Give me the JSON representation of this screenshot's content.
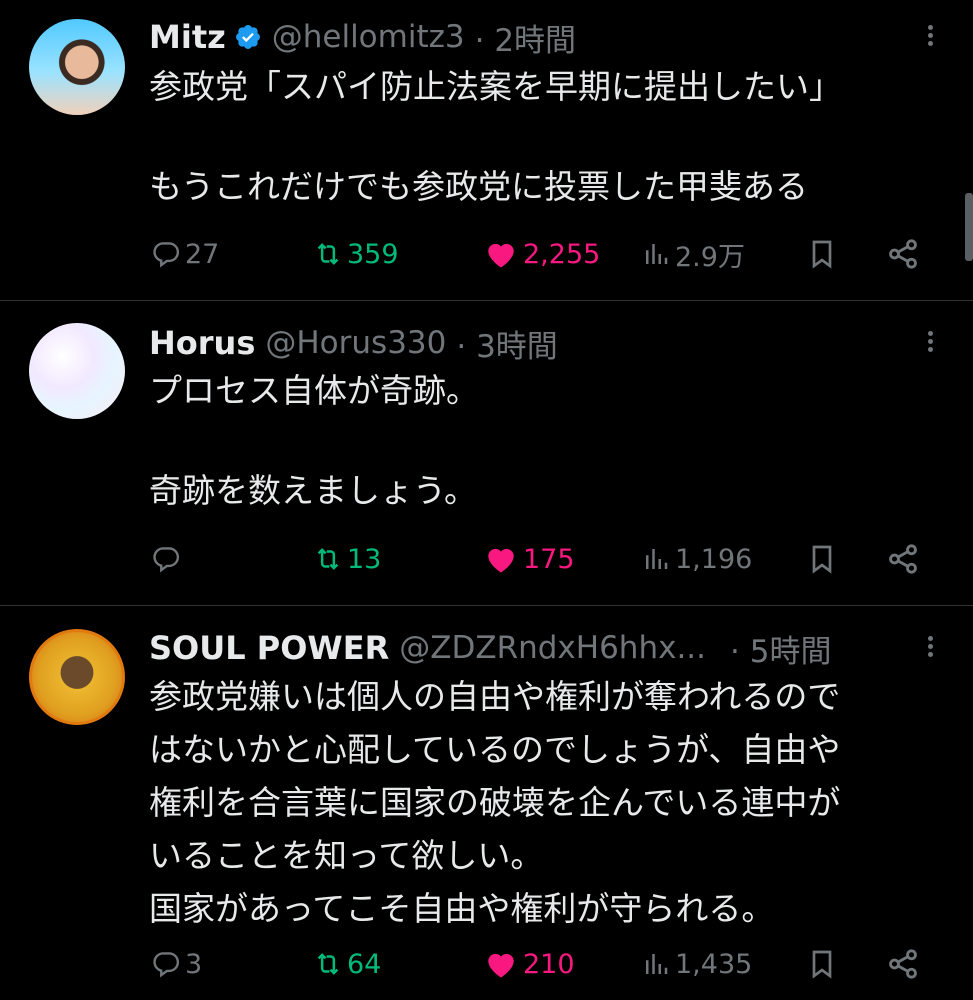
{
  "tweets": [
    {
      "name": "Mitz",
      "verified": true,
      "handle": "@hellomitz3",
      "time": "· 2時間",
      "body": "参政党「スパイ防止法案を早期に提出したい」\n\nもうこれだけでも参政党に投票した甲斐ある",
      "replies": "27",
      "retweets": "359",
      "likes": "2,255",
      "views": "2.9万",
      "liked": true,
      "retweeted": true
    },
    {
      "name": "Horus",
      "verified": false,
      "handle": "@Horus330",
      "time": "· 3時間",
      "body": "プロセス自体が奇跡。\n\n奇跡を数えましょう。",
      "replies": "",
      "retweets": "13",
      "likes": "175",
      "views": "1,196",
      "liked": true,
      "retweeted": true
    },
    {
      "name": "SOUL POWER",
      "verified": false,
      "handle": "@ZDZRndxH6hhx...",
      "time": "· 5時間",
      "body": "参政党嫌いは個人の自由や権利が奪われるので\nはないかと心配しているのでしょうが、自由や\n権利を合言葉に国家の破壊を企んでいる連中が\nいることを知って欲しい。\n国家があってこそ自由や権利が守られる。",
      "replies": "3",
      "retweets": "64",
      "likes": "210",
      "views": "1,435",
      "liked": true,
      "retweeted": true
    }
  ],
  "colors": {
    "background": "#000000",
    "text": "#e7e9ea",
    "muted": "#71767b",
    "retweet": "#00ba7c",
    "like": "#f91880",
    "verified": "#1d9bf0"
  }
}
